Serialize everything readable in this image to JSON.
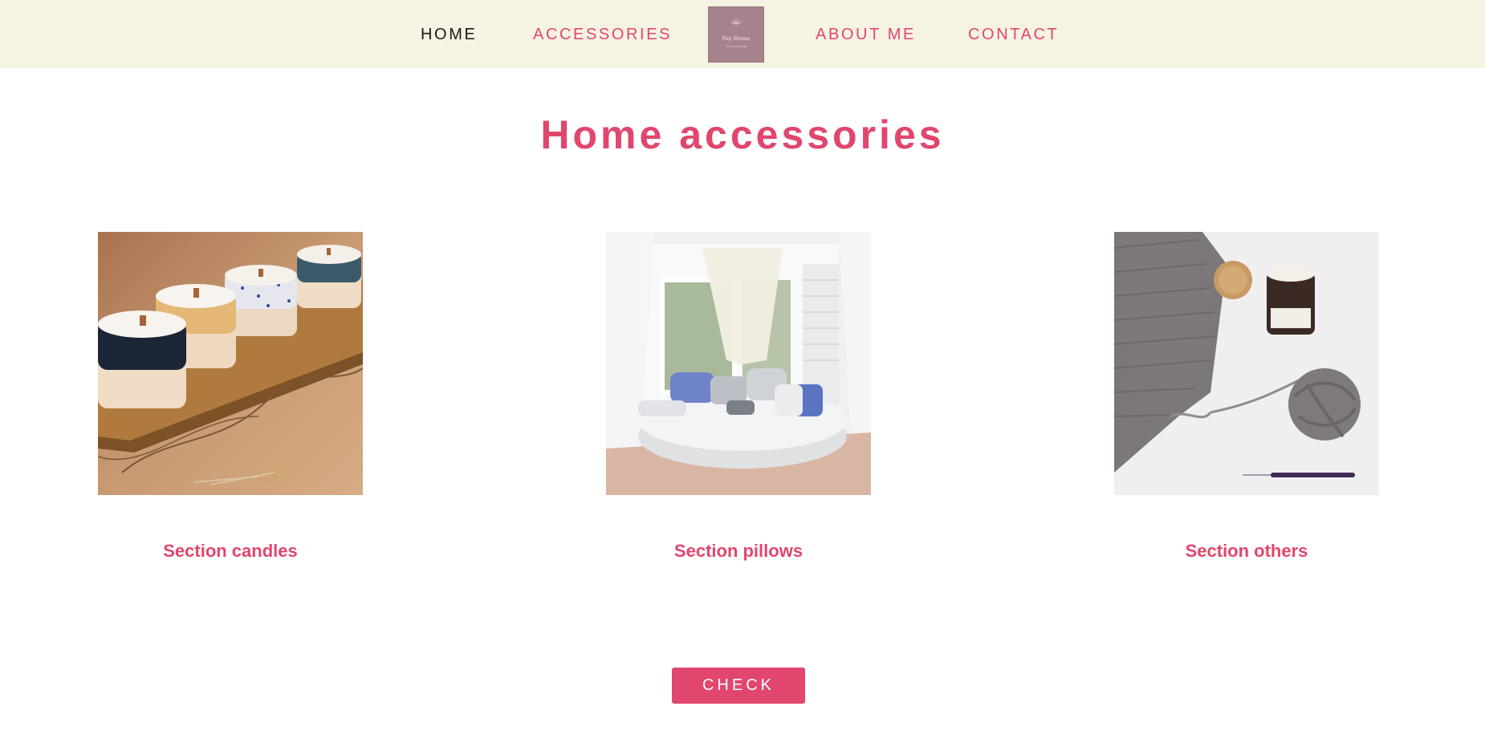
{
  "nav": {
    "home": "HOME",
    "accessories": "ACCESSORIES",
    "about": "ABOUT ME",
    "contact": "CONTACT",
    "logo_text": "Fay Home",
    "logo_subtext": "home accessories"
  },
  "main": {
    "title": "Home accessories",
    "sections": [
      {
        "label": "Section candles",
        "image": "candles-photo"
      },
      {
        "label": "Section pillows",
        "image": "pillows-photo"
      },
      {
        "label": "Section others",
        "image": "others-photo"
      }
    ],
    "check_button": "CHECK"
  },
  "colors": {
    "accent": "#e0466e",
    "nav_background": "#f7f3e3",
    "logo_background": "#a6838c",
    "active_link": "#1a1a1a"
  }
}
